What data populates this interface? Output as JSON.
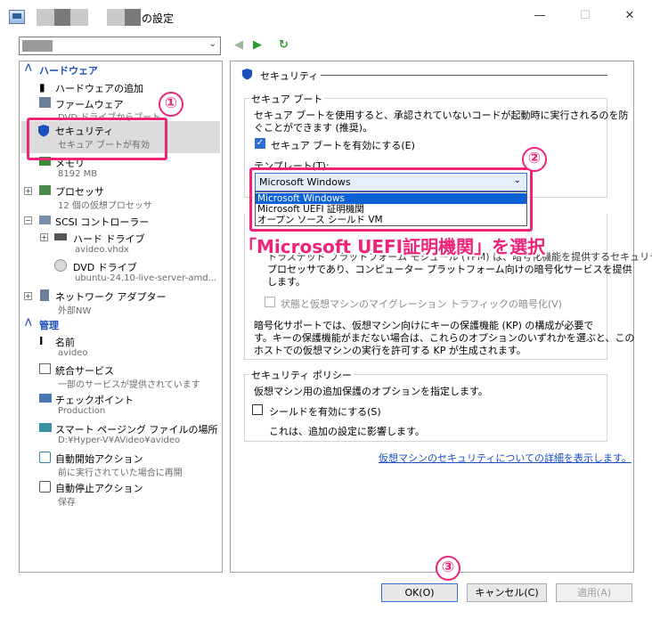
{
  "window": {
    "title_suffix": "の設定",
    "minimize": "—",
    "maximize": "☐",
    "close": "✕"
  },
  "toolbar": {
    "back": "◀",
    "forward": "▶",
    "refresh": "↻"
  },
  "sections": {
    "hardware": "ハードウェア",
    "management": "管理"
  },
  "tree": [
    {
      "label": "ハードウェアの追加",
      "sub": ""
    },
    {
      "label": "ファームウェア",
      "sub": "DVD ドライブからブート"
    },
    {
      "label": "セキュリティ",
      "sub": "セキュア ブートが有効"
    },
    {
      "label": "メモリ",
      "sub": "8192 MB"
    },
    {
      "label": "プロセッサ",
      "sub": "12 個の仮想プロセッサ"
    },
    {
      "label": "SCSI コントローラー",
      "sub": ""
    },
    {
      "label": "ハード ドライブ",
      "sub": "avideo.vhdx"
    },
    {
      "label": "DVD ドライブ",
      "sub": "ubuntu-24.10-live-server-amd..."
    },
    {
      "label": "ネットワーク アダプター",
      "sub": "外部NW"
    }
  ],
  "mgmt": [
    {
      "label": "名前",
      "sub": "avideo"
    },
    {
      "label": "統合サービス",
      "sub": "一部のサービスが提供されています"
    },
    {
      "label": "チェックポイント",
      "sub": "Production"
    },
    {
      "label": "スマート ページング ファイルの場所",
      "sub": "D:¥Hyper-V¥AVideo¥avideo"
    },
    {
      "label": "自動開始アクション",
      "sub": "前に実行されていた場合に再開"
    },
    {
      "label": "自動停止アクション",
      "sub": "保存"
    }
  ],
  "panel": {
    "header": "セキュリティ",
    "secure_boot": {
      "title": "セキュア ブート",
      "desc1": "セキュア ブートを使用すると、承認されていないコードが起動時に実行されるのを防",
      "desc2": "ぐことができます (推奨)。",
      "enable_label": "セキュア ブートを有効にする(E)",
      "template_label": "テンプレート(T):",
      "template_value": "Microsoft Windows",
      "options": [
        "Microsoft Windows",
        "Microsoft UEFI 証明機関",
        "オープン ソース シールド VM"
      ]
    },
    "encryption": {
      "line1": "トラステッド プラットフォーム モジュール (TPM) は、暗号化機能を提供するセキュリティ",
      "line2": "プロセッサであり、コンピューター プラットフォーム向けの暗号化サービスを提供",
      "line3": "します。",
      "migrate_label": "状態と仮想マシンのマイグレーション トラフィックの暗号化(V)",
      "note1": "暗号化サポートでは、仮想マシン向けにキーの保護機能 (KP) の構成が必要で",
      "note2": "す。キーの保護機能がまだない場合は、これらのオプションのいずれかを選ぶと、この",
      "note3": "ホストでの仮想マシンの実行を許可する KP が生成されます。"
    },
    "policy": {
      "title": "セキュリティ ポリシー",
      "desc": "仮想マシン用の追加保護のオプションを指定します。",
      "shield_label": "シールドを有効にする(S)",
      "shield_note": "これは、追加の設定に影響します。"
    },
    "link": "仮想マシンのセキュリティについての詳細を表示します。"
  },
  "buttons": {
    "ok": "OK(O)",
    "cancel": "キャンセル(C)",
    "apply": "適用(A)"
  },
  "annotations": {
    "n1": "①",
    "n2": "②",
    "n3": "③",
    "callout": "「Microsoft UEFI証明機関」を選択"
  },
  "colors": {
    "accent": "#f0237a",
    "section": "#1b4fbb",
    "selection": "#0a62d6"
  }
}
